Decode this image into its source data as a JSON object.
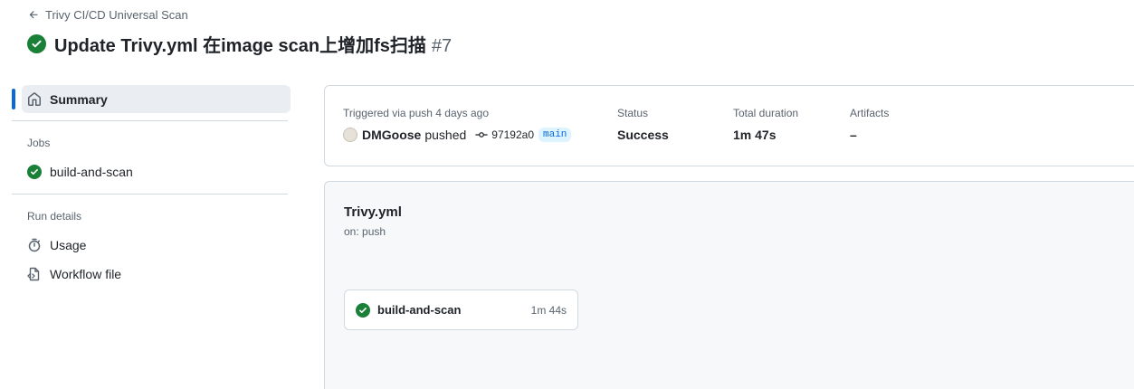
{
  "header": {
    "back_label": "Trivy CI/CD Universal Scan",
    "title": "Update Trivy.yml 在image scan上增加fs扫描",
    "run_number": "#7",
    "status_icon": "check-circle-fill-icon"
  },
  "sidebar": {
    "summary_label": "Summary",
    "jobs_title": "Jobs",
    "jobs": [
      {
        "label": "build-and-scan",
        "status": "success"
      }
    ],
    "run_details_title": "Run details",
    "run_details": [
      {
        "label": "Usage",
        "icon": "stopwatch-icon"
      },
      {
        "label": "Workflow file",
        "icon": "file-code-icon"
      }
    ]
  },
  "summary": {
    "triggered_label": "Triggered via push 4 days ago",
    "actor": "DMGoose",
    "action": "pushed",
    "commit": "97192a0",
    "branch": "main",
    "status_label": "Status",
    "status_value": "Success",
    "duration_label": "Total duration",
    "duration_value": "1m 47s",
    "artifacts_label": "Artifacts",
    "artifacts_value": "–"
  },
  "workflow": {
    "name": "Trivy.yml",
    "trigger": "on: push",
    "jobs": [
      {
        "label": "build-and-scan",
        "duration": "1m 44s"
      }
    ]
  },
  "colors": {
    "success": "#1a7f37",
    "accent": "#0969da",
    "muted_text": "#59636e",
    "border": "#d1d9e0",
    "panel_bg": "#f6f8fa"
  }
}
